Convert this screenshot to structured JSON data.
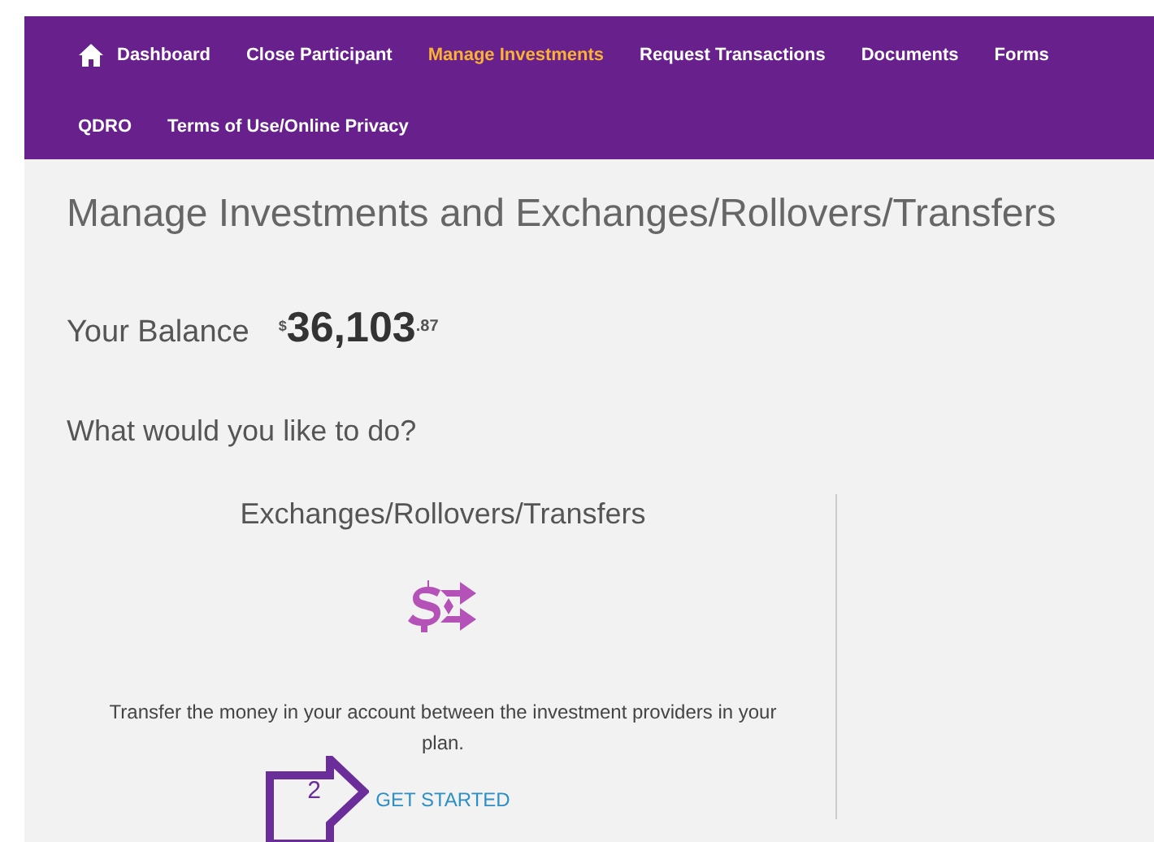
{
  "nav": {
    "items": [
      {
        "label": "Dashboard",
        "selected": false,
        "kind": "home"
      },
      {
        "label": "Close Participant",
        "selected": false
      },
      {
        "label": "Manage Investments",
        "selected": true
      },
      {
        "label": "Request Transactions",
        "selected": false
      },
      {
        "label": "Documents",
        "selected": false
      },
      {
        "label": "Forms",
        "selected": false
      },
      {
        "label": "QDRO",
        "selected": false
      },
      {
        "label": "Terms of Use/Online Privacy",
        "selected": false
      }
    ]
  },
  "title": "Manage Investments and Exchanges/Rollovers/Transfers",
  "balance": {
    "label": "Your Balance",
    "currency": "$",
    "whole": "36,103",
    "cents": ".87"
  },
  "question": "What would you like to do?",
  "card": {
    "title": "Exchanges/Rollovers/Transfers",
    "description": "Transfer the money in your account between the investment providers in your plan.",
    "link": "GET STARTED"
  },
  "callout": {
    "number": "2"
  }
}
